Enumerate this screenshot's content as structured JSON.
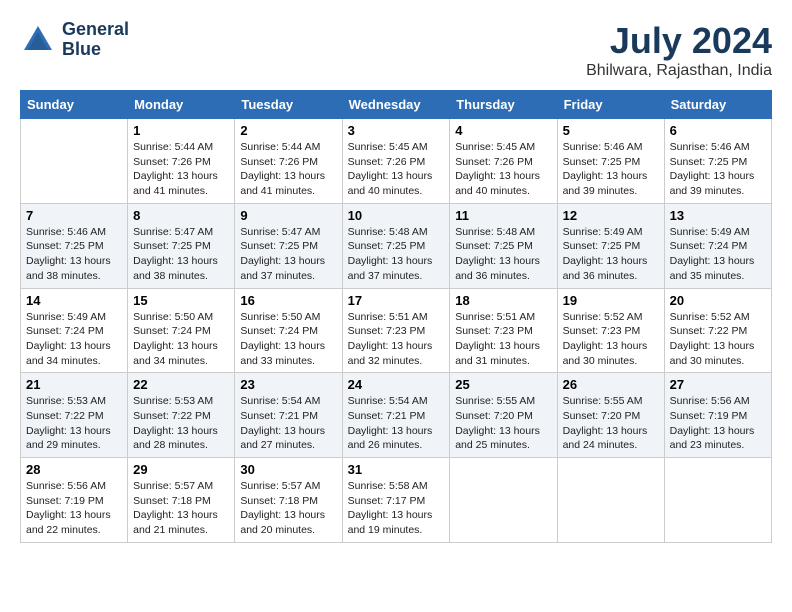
{
  "header": {
    "logo_line1": "General",
    "logo_line2": "Blue",
    "main_title": "July 2024",
    "subtitle": "Bhilwara, Rajasthan, India"
  },
  "calendar": {
    "days_of_week": [
      "Sunday",
      "Monday",
      "Tuesday",
      "Wednesday",
      "Thursday",
      "Friday",
      "Saturday"
    ],
    "weeks": [
      [
        {
          "day": "",
          "info": ""
        },
        {
          "day": "1",
          "info": "Sunrise: 5:44 AM\nSunset: 7:26 PM\nDaylight: 13 hours\nand 41 minutes."
        },
        {
          "day": "2",
          "info": "Sunrise: 5:44 AM\nSunset: 7:26 PM\nDaylight: 13 hours\nand 41 minutes."
        },
        {
          "day": "3",
          "info": "Sunrise: 5:45 AM\nSunset: 7:26 PM\nDaylight: 13 hours\nand 40 minutes."
        },
        {
          "day": "4",
          "info": "Sunrise: 5:45 AM\nSunset: 7:26 PM\nDaylight: 13 hours\nand 40 minutes."
        },
        {
          "day": "5",
          "info": "Sunrise: 5:46 AM\nSunset: 7:25 PM\nDaylight: 13 hours\nand 39 minutes."
        },
        {
          "day": "6",
          "info": "Sunrise: 5:46 AM\nSunset: 7:25 PM\nDaylight: 13 hours\nand 39 minutes."
        }
      ],
      [
        {
          "day": "7",
          "info": "Sunrise: 5:46 AM\nSunset: 7:25 PM\nDaylight: 13 hours\nand 38 minutes."
        },
        {
          "day": "8",
          "info": "Sunrise: 5:47 AM\nSunset: 7:25 PM\nDaylight: 13 hours\nand 38 minutes."
        },
        {
          "day": "9",
          "info": "Sunrise: 5:47 AM\nSunset: 7:25 PM\nDaylight: 13 hours\nand 37 minutes."
        },
        {
          "day": "10",
          "info": "Sunrise: 5:48 AM\nSunset: 7:25 PM\nDaylight: 13 hours\nand 37 minutes."
        },
        {
          "day": "11",
          "info": "Sunrise: 5:48 AM\nSunset: 7:25 PM\nDaylight: 13 hours\nand 36 minutes."
        },
        {
          "day": "12",
          "info": "Sunrise: 5:49 AM\nSunset: 7:25 PM\nDaylight: 13 hours\nand 36 minutes."
        },
        {
          "day": "13",
          "info": "Sunrise: 5:49 AM\nSunset: 7:24 PM\nDaylight: 13 hours\nand 35 minutes."
        }
      ],
      [
        {
          "day": "14",
          "info": "Sunrise: 5:49 AM\nSunset: 7:24 PM\nDaylight: 13 hours\nand 34 minutes."
        },
        {
          "day": "15",
          "info": "Sunrise: 5:50 AM\nSunset: 7:24 PM\nDaylight: 13 hours\nand 34 minutes."
        },
        {
          "day": "16",
          "info": "Sunrise: 5:50 AM\nSunset: 7:24 PM\nDaylight: 13 hours\nand 33 minutes."
        },
        {
          "day": "17",
          "info": "Sunrise: 5:51 AM\nSunset: 7:23 PM\nDaylight: 13 hours\nand 32 minutes."
        },
        {
          "day": "18",
          "info": "Sunrise: 5:51 AM\nSunset: 7:23 PM\nDaylight: 13 hours\nand 31 minutes."
        },
        {
          "day": "19",
          "info": "Sunrise: 5:52 AM\nSunset: 7:23 PM\nDaylight: 13 hours\nand 30 minutes."
        },
        {
          "day": "20",
          "info": "Sunrise: 5:52 AM\nSunset: 7:22 PM\nDaylight: 13 hours\nand 30 minutes."
        }
      ],
      [
        {
          "day": "21",
          "info": "Sunrise: 5:53 AM\nSunset: 7:22 PM\nDaylight: 13 hours\nand 29 minutes."
        },
        {
          "day": "22",
          "info": "Sunrise: 5:53 AM\nSunset: 7:22 PM\nDaylight: 13 hours\nand 28 minutes."
        },
        {
          "day": "23",
          "info": "Sunrise: 5:54 AM\nSunset: 7:21 PM\nDaylight: 13 hours\nand 27 minutes."
        },
        {
          "day": "24",
          "info": "Sunrise: 5:54 AM\nSunset: 7:21 PM\nDaylight: 13 hours\nand 26 minutes."
        },
        {
          "day": "25",
          "info": "Sunrise: 5:55 AM\nSunset: 7:20 PM\nDaylight: 13 hours\nand 25 minutes."
        },
        {
          "day": "26",
          "info": "Sunrise: 5:55 AM\nSunset: 7:20 PM\nDaylight: 13 hours\nand 24 minutes."
        },
        {
          "day": "27",
          "info": "Sunrise: 5:56 AM\nSunset: 7:19 PM\nDaylight: 13 hours\nand 23 minutes."
        }
      ],
      [
        {
          "day": "28",
          "info": "Sunrise: 5:56 AM\nSunset: 7:19 PM\nDaylight: 13 hours\nand 22 minutes."
        },
        {
          "day": "29",
          "info": "Sunrise: 5:57 AM\nSunset: 7:18 PM\nDaylight: 13 hours\nand 21 minutes."
        },
        {
          "day": "30",
          "info": "Sunrise: 5:57 AM\nSunset: 7:18 PM\nDaylight: 13 hours\nand 20 minutes."
        },
        {
          "day": "31",
          "info": "Sunrise: 5:58 AM\nSunset: 7:17 PM\nDaylight: 13 hours\nand 19 minutes."
        },
        {
          "day": "",
          "info": ""
        },
        {
          "day": "",
          "info": ""
        },
        {
          "day": "",
          "info": ""
        }
      ]
    ]
  }
}
